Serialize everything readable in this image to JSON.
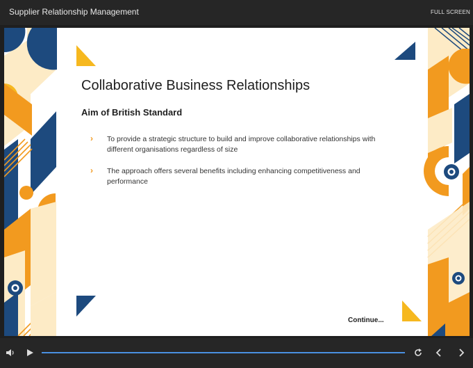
{
  "app": {
    "title": "Supplier Relationship Management",
    "fullscreen_label": "FULL SCREEN"
  },
  "slide": {
    "title": "Collaborative Business Relationships",
    "subtitle": "Aim of British Standard",
    "bullets": [
      "To provide a strategic structure to build and improve collaborative relationships with different organisations regardless of size",
      "The approach offers several benefits including enhancing competitiveness and performance"
    ],
    "continue_label": "Continue..."
  },
  "player": {
    "progress_fraction": 1.0,
    "icons": [
      "volume-icon",
      "play-icon",
      "replay-icon",
      "prev-icon",
      "next-icon"
    ]
  },
  "colors": {
    "orange": "#f29a1f",
    "navy": "#1d4a7e",
    "cream": "#fdebc6",
    "gold": "#f6b81f"
  }
}
